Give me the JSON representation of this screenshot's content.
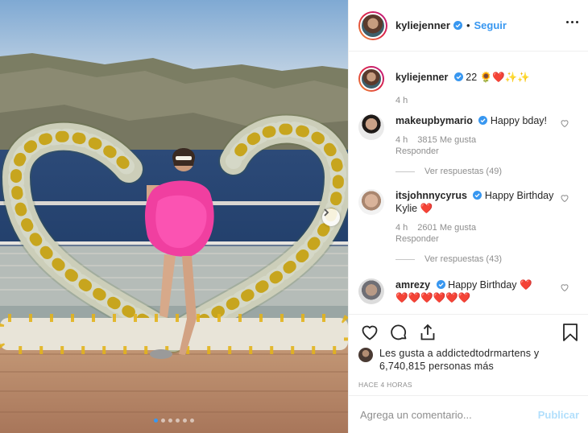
{
  "post": {
    "username": "kyliejenner",
    "follow_label": "Seguir",
    "separator": "•"
  },
  "caption": {
    "username": "kyliejenner",
    "text": "22 🌻❤️✨✨",
    "time": "4 h"
  },
  "comments": [
    {
      "username": "makeupbymario",
      "text": "Happy bday!",
      "time": "4 h",
      "likes": "3815 Me gusta",
      "reply_label": "Responder",
      "view_replies": "Ver respuestas (49)"
    },
    {
      "username": "itsjohnnycyrus",
      "text": "Happy Birthday Kylie ❤️",
      "time": "4 h",
      "likes": "2601 Me gusta",
      "reply_label": "Responder",
      "view_replies": "Ver respuestas (43)"
    },
    {
      "username": "amrezy",
      "text": "Happy Birthday ❤️",
      "extra": "❤️❤️❤️❤️❤️❤️"
    }
  ],
  "likes_text": "Les gusta a addictedtodrmartens y 6,740,815 personas más",
  "timestamp": "HACE 4 HORAS",
  "comment_input": {
    "placeholder": "Agrega un comentario...",
    "publish_label": "Publicar"
  },
  "carousel": {
    "total": 6,
    "active": 1
  },
  "colors": {
    "accent": "#3897f0",
    "text": "#262626",
    "muted": "#8e8e8e",
    "heart": "#ed4956"
  }
}
